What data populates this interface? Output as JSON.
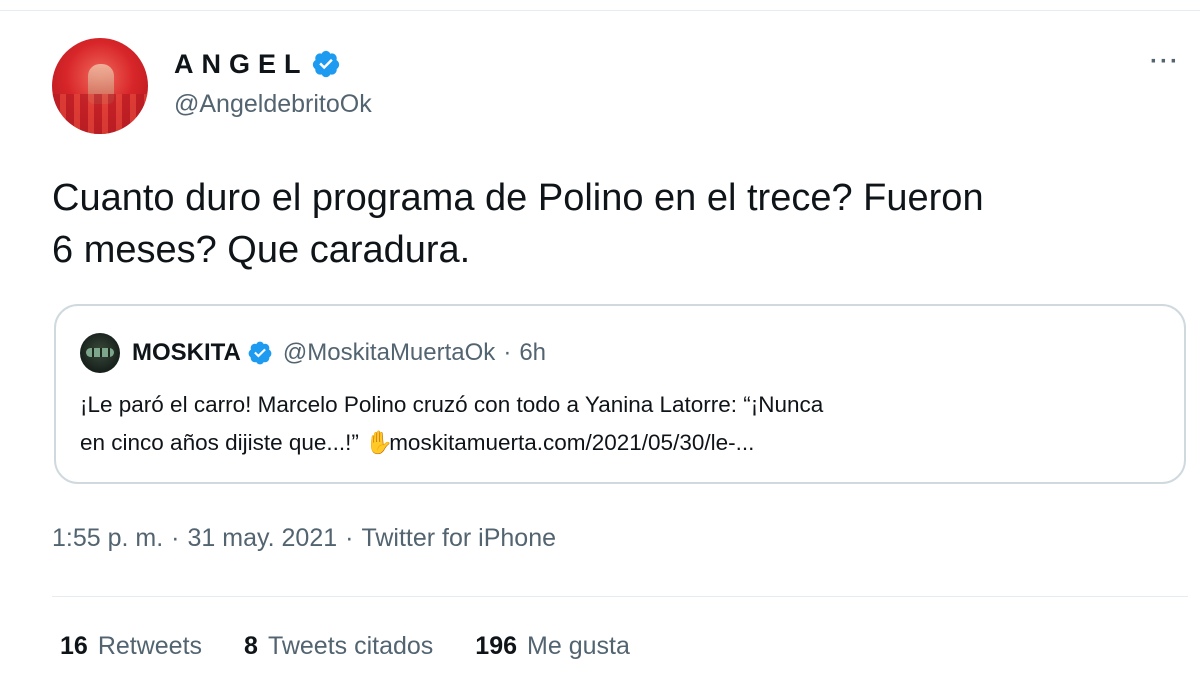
{
  "author": {
    "display_name": "ANGEL",
    "handle": "@AngeldebritoOk",
    "verified": true,
    "avatar_icon": "red-stage-avatar"
  },
  "more_label": "···",
  "tweet": {
    "text": "Cuanto duro el programa de Polino en el trece? Fueron\n6 meses? Que caradura."
  },
  "quote": {
    "display_name": "MOSKITA",
    "handle": "@MoskitaMuertaOk",
    "separator": "·",
    "time": "6h",
    "verified": true,
    "avatar_icon": "mosquito-eyes-avatar",
    "text_line1": "¡Le paró el carro! Marcelo Polino cruzó con todo a Yanina Latorre: “¡Nunca",
    "text_line2_prefix": "en cinco años dijiste que...!”",
    "emoji": "✋",
    "link": "moskitamuerta.com/2021/05/30/le-..."
  },
  "meta": {
    "time": "1:55 p. m.",
    "separator": "·",
    "date": "31 may. 2021",
    "source": "Twitter for iPhone"
  },
  "stats": [
    {
      "count": "16",
      "label": "Retweets"
    },
    {
      "count": "8",
      "label": "Tweets citados"
    },
    {
      "count": "196",
      "label": "Me gusta"
    }
  ],
  "colors": {
    "verified_blue": "#1d9bf0",
    "secondary_text": "#536471",
    "border": "#cfd9de"
  }
}
